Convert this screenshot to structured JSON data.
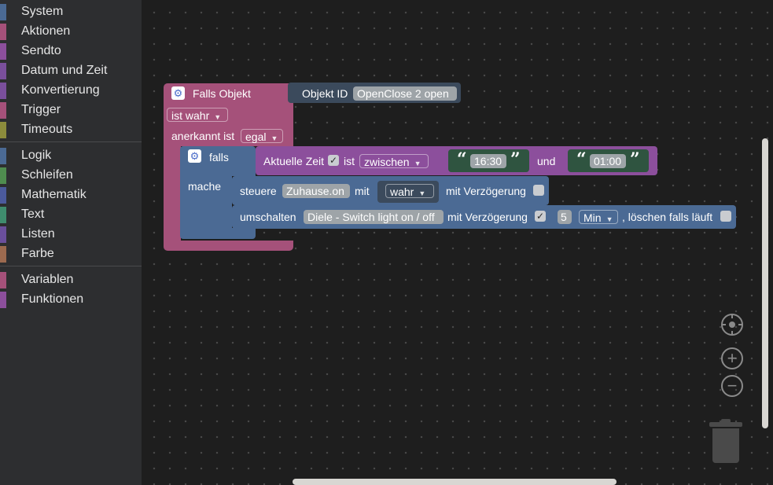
{
  "toolbox": {
    "group1": [
      {
        "label": "System",
        "color": "#4b6a94"
      },
      {
        "label": "Aktionen",
        "color": "#a5517a"
      },
      {
        "label": "Sendto",
        "color": "#8c4f9c"
      },
      {
        "label": "Datum und Zeit",
        "color": "#7a4f9c"
      },
      {
        "label": "Konvertierung",
        "color": "#7a4f9c"
      },
      {
        "label": "Trigger",
        "color": "#a5517a"
      },
      {
        "label": "Timeouts",
        "color": "#8c8c3c"
      }
    ],
    "group2": [
      {
        "label": "Logik",
        "color": "#4b6a94"
      },
      {
        "label": "Schleifen",
        "color": "#4f8c4f"
      },
      {
        "label": "Mathematik",
        "color": "#4b5a9c"
      },
      {
        "label": "Text",
        "color": "#3f8c6e"
      },
      {
        "label": "Listen",
        "color": "#6a4f9c"
      },
      {
        "label": "Farbe",
        "color": "#9c6a4f"
      }
    ],
    "group3": [
      {
        "label": "Variablen",
        "color": "#a5517a"
      },
      {
        "label": "Funktionen",
        "color": "#8c4f9c"
      }
    ]
  },
  "blocks": {
    "trigger": {
      "title": "Falls Objekt",
      "condition": "ist wahr",
      "ack_label": "anerkannt ist",
      "ack_value": "egal"
    },
    "object_id": {
      "label": "Objekt ID",
      "value": "OpenClose 2 open"
    },
    "if_block": {
      "if_label": "falls",
      "do_label": "mache"
    },
    "time_check": {
      "label": "Aktuelle Zeit",
      "checkbox": "✓",
      "ist_label": "ist",
      "mode": "zwischen",
      "start": "16:30",
      "and_label": "und",
      "end": "01:00",
      "open_quote": "“",
      "close_quote": "”"
    },
    "control": {
      "label": "steuere",
      "target": "Zuhause.on",
      "with_label": "mit",
      "value": "wahr",
      "delay_label": "mit Verzögerung"
    },
    "toggle": {
      "label": "umschalten",
      "target": "Diele - Switch light on / off",
      "delay_label": "mit Verzögerung",
      "checkbox": "✓",
      "amount": "5",
      "unit": "Min",
      "clear_label": ", löschen falls läuft"
    }
  },
  "controls": {
    "center_icon": "crosshair-icon",
    "zoom_in_icon": "plus-icon",
    "zoom_out_icon": "minus-icon",
    "trash_icon": "trash-icon"
  }
}
